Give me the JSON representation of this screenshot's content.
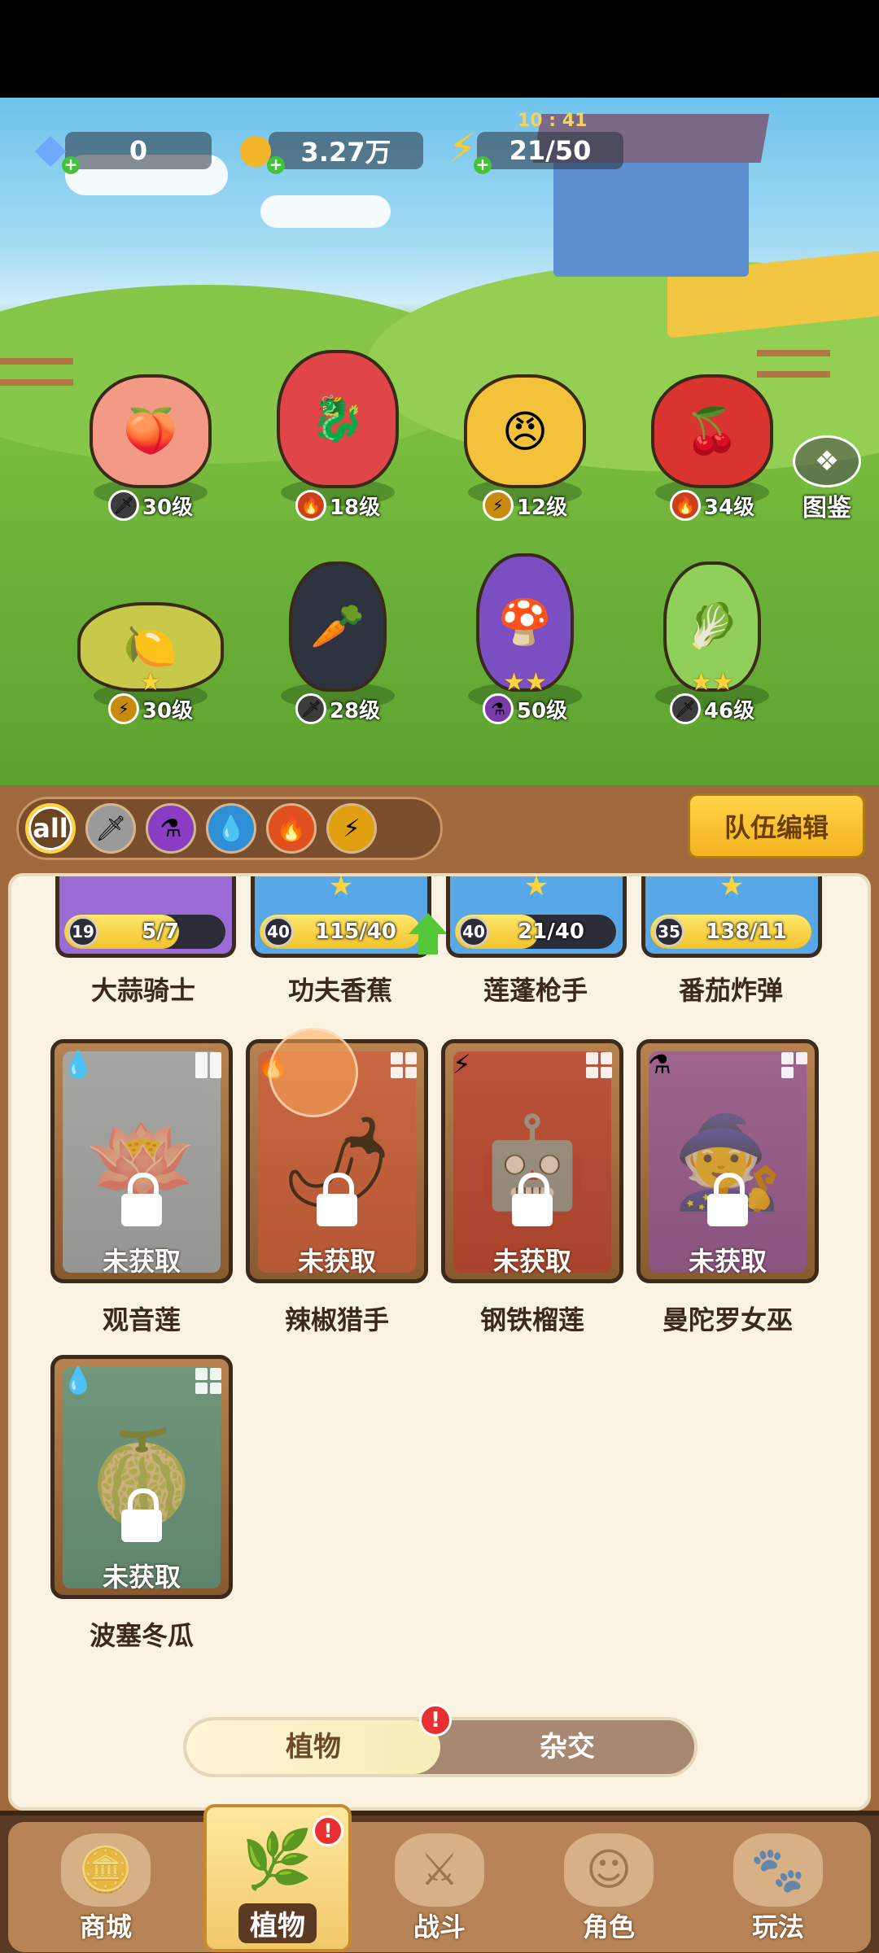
{
  "resources": {
    "gems": "0",
    "coins": "3.27万",
    "energy": "21/50",
    "energy_timer": "10 : 41"
  },
  "album_label": "图鉴",
  "lineup": [
    {
      "level": "30级",
      "element": "sword",
      "stars": ""
    },
    {
      "level": "18级",
      "element": "fire",
      "stars": ""
    },
    {
      "level": "12级",
      "element": "lightning",
      "stars": ""
    },
    {
      "level": "34级",
      "element": "fire",
      "stars": ""
    },
    {
      "level": "30级",
      "element": "lightning",
      "stars": "★"
    },
    {
      "level": "28级",
      "element": "sword",
      "stars": ""
    },
    {
      "level": "50级",
      "element": "poison",
      "stars": "★★"
    },
    {
      "level": "46级",
      "element": "sword",
      "stars": "★★"
    }
  ],
  "filters": {
    "all_label": "all",
    "icons": [
      "sword-icon",
      "potion-icon",
      "water-drop-icon",
      "fire-icon",
      "lightning-icon"
    ]
  },
  "team_edit_label": "队伍编辑",
  "owned_cards": [
    {
      "name": "大蒜骑士",
      "level": "19",
      "progress": "5/7",
      "progress_fraction": 0.71,
      "color": "#9b6bd6"
    },
    {
      "name": "功夫香蕉",
      "level": "40",
      "progress": "115/40",
      "progress_fraction": 1.0,
      "color": "#58a8e8"
    },
    {
      "name": "莲蓬枪手",
      "level": "40",
      "progress": "21/40",
      "progress_fraction": 0.52,
      "color": "#58a8e8"
    },
    {
      "name": "番茄炸弹",
      "level": "35",
      "progress": "138/11",
      "progress_fraction": 1.0,
      "color": "#58a8e8"
    }
  ],
  "locked_label": "未获取",
  "locked_cards": [
    {
      "name": "观音莲",
      "element": "water-drop-icon"
    },
    {
      "name": "辣椒猎手",
      "element": "fire-icon"
    },
    {
      "name": "钢铁榴莲",
      "element": "lightning-icon"
    },
    {
      "name": "曼陀罗女巫",
      "element": "potion-icon"
    },
    {
      "name": "波塞冬瓜",
      "element": "water-drop-icon"
    }
  ],
  "toggle": {
    "left": "植物",
    "right": "杂交",
    "badge": "!"
  },
  "nav": {
    "shop": "商城",
    "plants": "植物",
    "battle": "战斗",
    "character": "角色",
    "gameplay": "玩法",
    "plants_badge": "!"
  },
  "colors": {
    "accent": "#ffd43a",
    "panel": "#a06a3e",
    "card_area": "#fbf3e1"
  }
}
